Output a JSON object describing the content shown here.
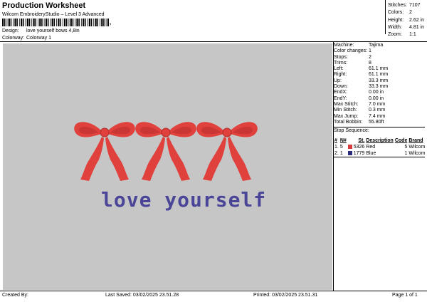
{
  "header": {
    "title": "Production Worksheet",
    "subtitle": "Wilcom EmbroideryStudio – Level 3 Advanced",
    "barcode_suffix": ",",
    "design_label": "Design:",
    "design_value": "love yourself bows 4,8in",
    "colorway_label": "Colorway:",
    "colorway_value": "Colorway 1"
  },
  "stats": [
    {
      "label": "Stitches:",
      "value": "7107"
    },
    {
      "label": "Colors:",
      "value": "2"
    },
    {
      "label": "Height:",
      "value": "2.62 in"
    },
    {
      "label": "Width:",
      "value": "4.81 in"
    },
    {
      "label": "Zoom:",
      "value": "1:1"
    }
  ],
  "properties": {
    "group1": [
      {
        "label": "Machine:",
        "value": "Tajima"
      },
      {
        "label": "Color changes:",
        "value": "1"
      },
      {
        "label": "Stops:",
        "value": "2"
      },
      {
        "label": "Trims:",
        "value": "8"
      },
      {
        "label": "Left:",
        "value": "61.1 mm"
      },
      {
        "label": "Right:",
        "value": "61.1 mm"
      },
      {
        "label": "Up:",
        "value": "33.3 mm"
      },
      {
        "label": "Down:",
        "value": "33.3 mm"
      },
      {
        "label": "EndX:",
        "value": "0.00 in"
      },
      {
        "label": "EndY:",
        "value": "0.00 in"
      },
      {
        "label": "Max Stitch:",
        "value": "7.0 mm"
      },
      {
        "label": "Min Stitch:",
        "value": "0.3 mm"
      },
      {
        "label": "Max Jump:",
        "value": "7.4 mm"
      },
      {
        "label": "Total Bobbin:",
        "value": "55.80ft"
      }
    ],
    "stop_sequence_label": "Stop Sequence:"
  },
  "stop_table": {
    "headers": [
      "#",
      "N#",
      "St.",
      "Description",
      "Code",
      "Brand"
    ],
    "rows": [
      {
        "num": "1.",
        "needle": "5",
        "stitches": "5326",
        "description": "Red",
        "code": "5",
        "brand": "Wilcom",
        "color": "#d63a3a"
      },
      {
        "num": "2.",
        "needle": "1",
        "stitches": "1779",
        "description": "Blue",
        "code": "1",
        "brand": "Wilcom",
        "color": "#2c2a7a"
      }
    ]
  },
  "design": {
    "text": "love yourself",
    "text_color": "#4a4596",
    "bow_color": "#e0413c",
    "bow_shadow": "#b02a28",
    "canvas_bg": "#c6c6c6"
  },
  "footer": {
    "created_by": "Created By:",
    "last_saved": "Last Saved: 03/02/2025 23.51.28",
    "printed": "Printed: 03/02/2025 23.51.31",
    "page": "Page 1 of 1"
  }
}
